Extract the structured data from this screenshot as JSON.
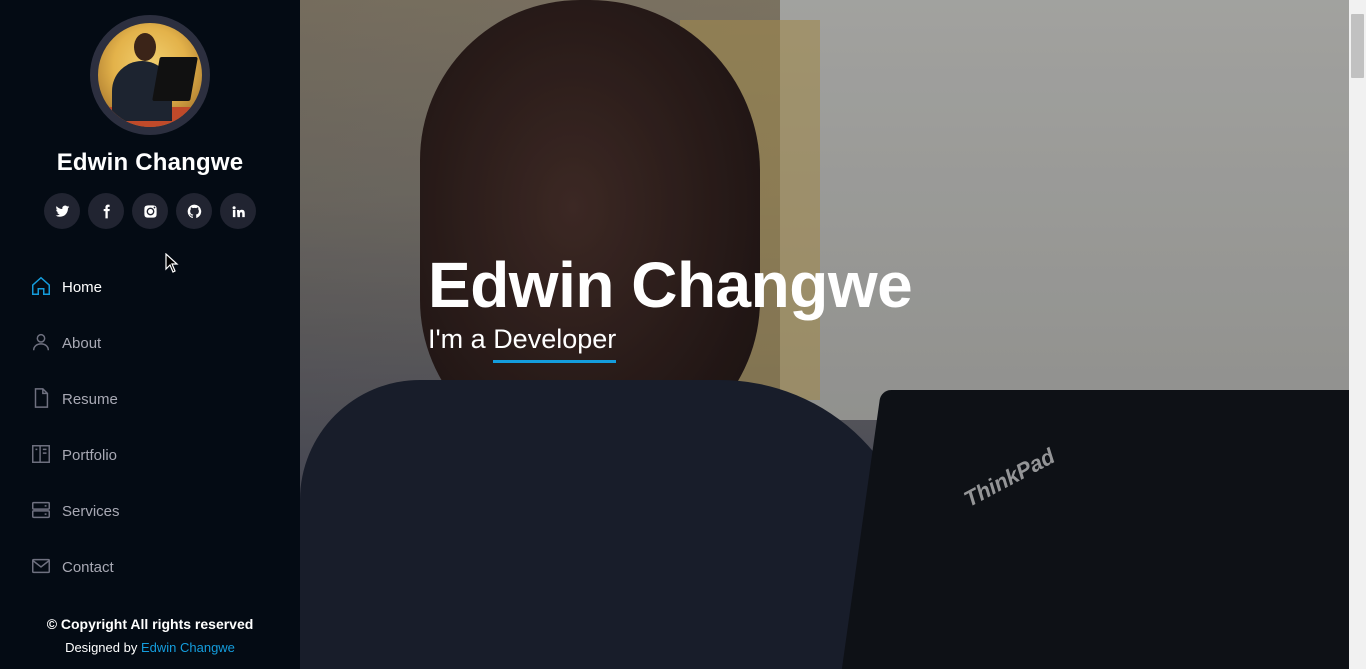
{
  "profile": {
    "name": "Edwin Changwe"
  },
  "social": [
    {
      "icon": "twitter-icon"
    },
    {
      "icon": "facebook-icon"
    },
    {
      "icon": "instagram-icon"
    },
    {
      "icon": "github-icon"
    },
    {
      "icon": "linkedin-icon"
    }
  ],
  "nav": {
    "items": [
      {
        "label": "Home",
        "icon": "home-icon",
        "active": true
      },
      {
        "label": "About",
        "icon": "person-icon",
        "active": false
      },
      {
        "label": "Resume",
        "icon": "file-icon",
        "active": false
      },
      {
        "label": "Portfolio",
        "icon": "portfolio-icon",
        "active": false
      },
      {
        "label": "Services",
        "icon": "server-icon",
        "active": false
      },
      {
        "label": "Contact",
        "icon": "envelope-icon",
        "active": false
      }
    ]
  },
  "footer": {
    "copyright": "© Copyright All rights reserved",
    "designed_by": "Designed by",
    "author": "Edwin Changwe"
  },
  "hero": {
    "title": "Edwin Changwe",
    "subtitle_prefix": "I'm a",
    "subtitle_typed": "Developer",
    "laptop_brand": "ThinkPad"
  },
  "colors": {
    "accent": "#149ddd",
    "sidebar_bg": "#040b14",
    "social_bg": "#212431",
    "nav_text": "#a8a9b4"
  }
}
